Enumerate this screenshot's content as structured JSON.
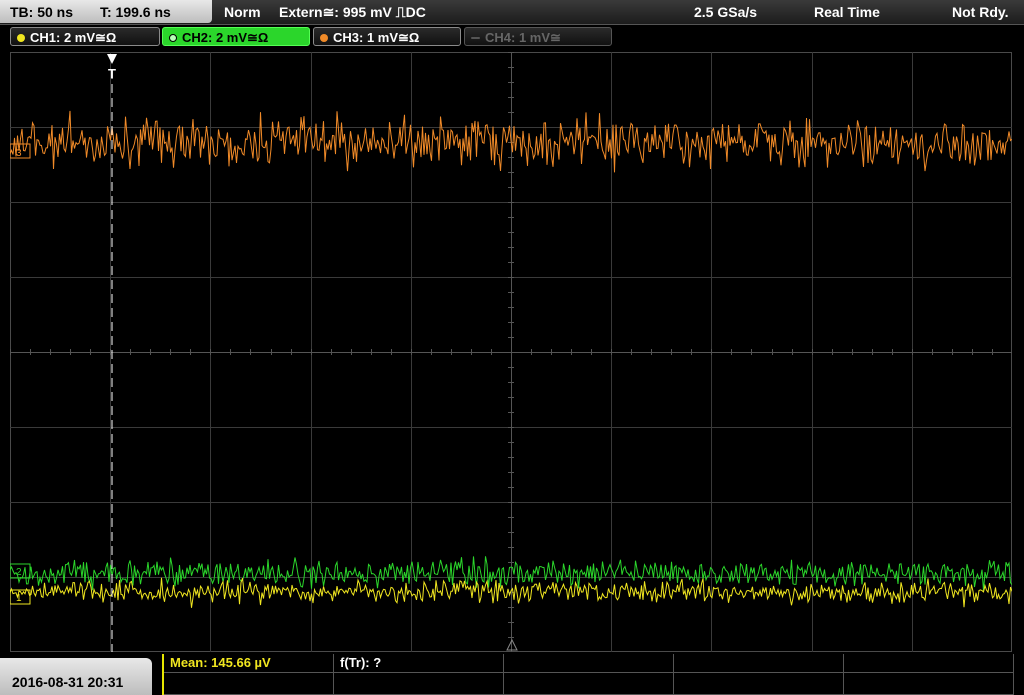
{
  "status_bar": {
    "timebase": "TB: 50 ns",
    "trigger_time": "T: 199.6 ns",
    "trigger_mode": "Norm",
    "trigger_source": "Extern≅: 995 mV ⎍DC",
    "sample_rate": "2.5 GSa/s",
    "acquisition_mode": "Real Time",
    "status": "Not Rdy."
  },
  "channels": [
    {
      "label": "CH1: 2 mV≅Ω",
      "color": "#f0e620",
      "state": "on"
    },
    {
      "label": "CH2: 2 mV≅Ω",
      "color": "#2bd62b",
      "state": "active"
    },
    {
      "label": "CH3: 1 mV≅Ω",
      "color": "#f08a28",
      "state": "on"
    },
    {
      "label": "CH4: 1 mV≅",
      "color": "#777777",
      "state": "off"
    }
  ],
  "waveforms": [
    {
      "name": "CH3",
      "color": "#f08a28",
      "center_div": 1.2,
      "spread_div": 0.35
    },
    {
      "name": "CH2",
      "color": "#2bd62b",
      "center_div": 6.95,
      "spread_div": 0.2
    },
    {
      "name": "CH1",
      "color": "#f0e620",
      "center_div": 7.2,
      "spread_div": 0.16
    }
  ],
  "markers": {
    "trigger": "T",
    "ch3_ref": "3",
    "ch2_ref": "2",
    "ch1_ref": "1"
  },
  "footer": {
    "datetime": "2016-08-31 20:31",
    "mean": "Mean: 145.66 µV",
    "rise_freq": "f(Tr): ?"
  },
  "colors": {
    "grid": "#3a3a3a",
    "grid_center": "#555555",
    "trigger_line": "#ffffff"
  }
}
